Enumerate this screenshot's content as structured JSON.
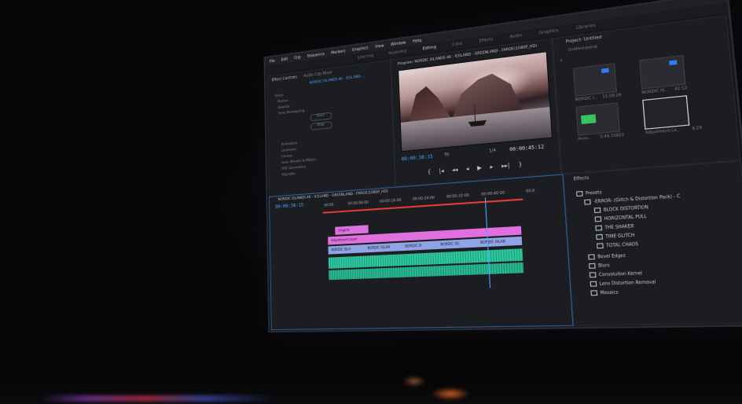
{
  "menu": [
    "File",
    "Edit",
    "Clip",
    "Sequence",
    "Markers",
    "Graphics",
    "View",
    "Window",
    "Help"
  ],
  "workspaces": [
    "Learning",
    "Assembly",
    "Editing",
    "Color",
    "Effects",
    "Audio",
    "Graphics",
    "Libraries"
  ],
  "workspace_active": "Editing",
  "source_panel": {
    "tab_source": "Effect Controls",
    "tab_ec": "Audio Clip Mixer",
    "clip_label": "NORDIC ISLANDS 4K - ICELAND ...",
    "rows": [
      "Video",
      "Motion",
      "Opacity",
      "Time Remapping"
    ],
    "label_a": "Start",
    "label_b": "Stop",
    "fx_rows": [
      "Animation",
      "Loudness",
      "Curves",
      "Lens Wheels & Match",
      "HSL Secondary",
      "Vignette"
    ]
  },
  "program": {
    "title": "Program: NORDIC ISLANDS 4K - ICELAND - GREENLAND - FAROE(1080P_HD)",
    "timecode_left": "00:00:38:15",
    "fit": "Fit",
    "fraction": "1/4",
    "timecode_right": "00:00:45:12",
    "controls": [
      "{",
      "|◂",
      "◂◂",
      "◂",
      "▶",
      "▸",
      "▸▸|",
      "}"
    ]
  },
  "project": {
    "title": "Project: Untitled",
    "file": "Untitled.prproj",
    "items": [
      {
        "name": "NORDIC I...",
        "dur": "11:09:20"
      },
      {
        "name": "NORDIC IS...",
        "dur": "42:12"
      },
      {
        "name": "Auro...",
        "dur": "5:46:10823"
      },
      {
        "name": "Adjustment La...",
        "dur": "4:29"
      }
    ]
  },
  "timeline": {
    "title": "NORDIC ISLANDS 4K - ICELAND - GREENLAND - FAROE(1080P_HD)",
    "timecode": "00:00:38:15",
    "ruler": [
      "00:00",
      "00:00:08:00",
      "00:00:16:00",
      "00:00:24:00",
      "00:00:32:00",
      "00:00:40:00",
      "00:0"
    ],
    "clip_v3": "Graphic",
    "clip_v2": "Adjustment Layer",
    "clips_v1": [
      "NORDIC ISLA",
      "NORDIC ISLAN",
      "NORDIC IS",
      "NORDIC ISL",
      "NORDIC ISLAN"
    ]
  },
  "effects": {
    "title": "Effects",
    "items": [
      "Presets",
      "-ERROR- (Glitch & Distortion Pack) - C",
      "BLOCK DISTORTION",
      "HORIZONTAL PULL",
      "THE SHAKER",
      "TIME GLITCH",
      "TOTAL CHAOS",
      "Bevel Edges",
      "Blurs",
      "Convolution Kernel",
      "Lens Distortion Removal",
      "Mosaics"
    ]
  },
  "colors": {
    "accent": "#2f7bff",
    "playhead": "#e43a3a",
    "video_clip": "#8fa4e6",
    "graphic_clip": "#e070e0",
    "audio_clip": "#2ec9a0"
  }
}
